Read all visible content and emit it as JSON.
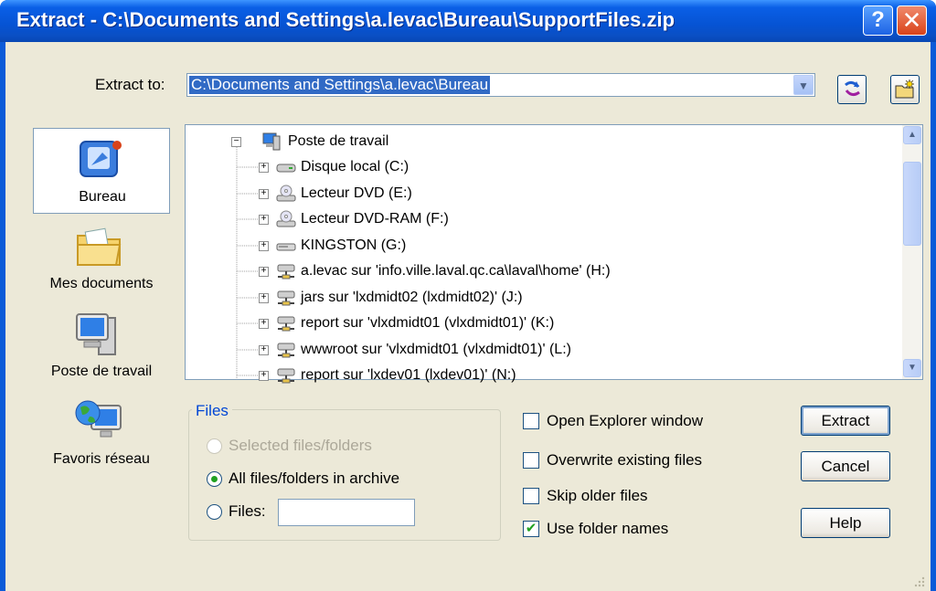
{
  "window": {
    "title": "Extract - C:\\Documents and Settings\\a.levac\\Bureau\\SupportFiles.zip",
    "help_glyph": "?",
    "close_glyph": "✕"
  },
  "extract_to": {
    "label": "Extract to:",
    "value": "C:\\Documents and Settings\\a.levac\\Bureau"
  },
  "places": [
    {
      "label": "Bureau",
      "icon": "desktop-icon",
      "selected": true
    },
    {
      "label": "Mes documents",
      "icon": "folder-icon",
      "selected": false
    },
    {
      "label": "Poste de travail",
      "icon": "computer-icon",
      "selected": false
    },
    {
      "label": "Favoris réseau",
      "icon": "network-icon",
      "selected": false
    }
  ],
  "tree": {
    "root": {
      "label": "Poste de travail",
      "icon": "computer-icon"
    },
    "items": [
      {
        "label": "Disque local (C:)",
        "icon": "hard-drive-icon"
      },
      {
        "label": "Lecteur DVD (E:)",
        "icon": "dvd-drive-icon"
      },
      {
        "label": "Lecteur DVD-RAM (F:)",
        "icon": "dvd-drive-icon"
      },
      {
        "label": "KINGSTON (G:)",
        "icon": "removable-drive-icon"
      },
      {
        "label": "a.levac sur 'info.ville.laval.qc.ca\\laval\\home' (H:)",
        "icon": "network-drive-icon"
      },
      {
        "label": "jars sur 'lxdmidt02 (lxdmidt02)' (J:)",
        "icon": "network-drive-icon"
      },
      {
        "label": "report sur 'vlxdmidt01 (vlxdmidt01)' (K:)",
        "icon": "network-drive-icon"
      },
      {
        "label": "wwwroot sur 'vlxdmidt01 (vlxdmidt01)' (L:)",
        "icon": "network-drive-icon"
      },
      {
        "label": "report sur 'lxdev01 (lxdev01)' (N:)",
        "icon": "network-drive-icon"
      }
    ]
  },
  "files_group": {
    "title": "Files",
    "selected_label": "Selected files/folders",
    "all_label": "All files/folders in archive",
    "files_label": "Files:",
    "files_value": ""
  },
  "options": {
    "open_explorer": {
      "label": "Open Explorer window",
      "checked": false
    },
    "overwrite": {
      "label": "Overwrite existing files",
      "checked": false
    },
    "skip_older": {
      "label": "Skip older files",
      "checked": false
    },
    "use_folder_names": {
      "label": "Use folder names",
      "checked": true
    }
  },
  "buttons": {
    "extract": "Extract",
    "cancel": "Cancel",
    "help": "Help"
  },
  "colors": {
    "titlebar": "#0653d3",
    "dialog_bg": "#ece9d8",
    "selection": "#316ac5",
    "group_title": "#0046d5",
    "check_mark": "#21a121"
  }
}
